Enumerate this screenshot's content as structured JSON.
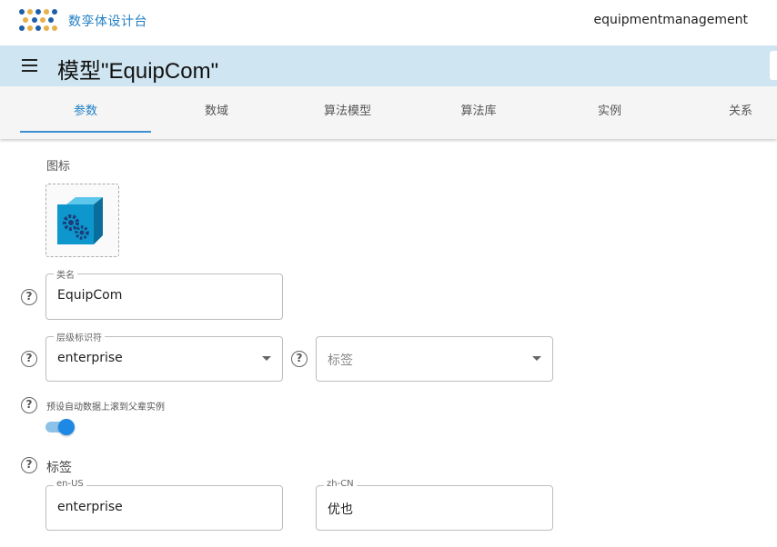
{
  "app": {
    "brand": "数孪体设计台",
    "user": "equipmentmanagement",
    "logo_colors": [
      "#1f5fa8",
      "#e8b04a"
    ]
  },
  "title": {
    "text": "模型\"EquipCom\""
  },
  "tabs": [
    {
      "label": "参数",
      "active": true
    },
    {
      "label": "数域",
      "active": false
    },
    {
      "label": "算法模型",
      "active": false
    },
    {
      "label": "算法库",
      "active": false
    },
    {
      "label": "实例",
      "active": false
    },
    {
      "label": "关系",
      "active": false
    }
  ],
  "form": {
    "icon_label": "图标",
    "icon_name": "cube-gears-icon",
    "class_name": {
      "legend": "类名",
      "value": "EquipCom"
    },
    "hierarchy": {
      "legend": "层级标识符",
      "value": "enterprise"
    },
    "tag_select": {
      "placeholder": "标签"
    },
    "rollup": {
      "label": "预设自动数据上滚到父辈实例",
      "enabled": true
    },
    "tags_title": "标签",
    "tag_en": {
      "legend": "en-US",
      "value": "enterprise"
    },
    "tag_zh": {
      "legend": "zh-CN",
      "value": "优也"
    }
  },
  "help_glyph": "?",
  "colors": {
    "accent": "#1f7fc4",
    "title_bar": "#cfe5f1",
    "toggle_on": "#1e88e5"
  }
}
